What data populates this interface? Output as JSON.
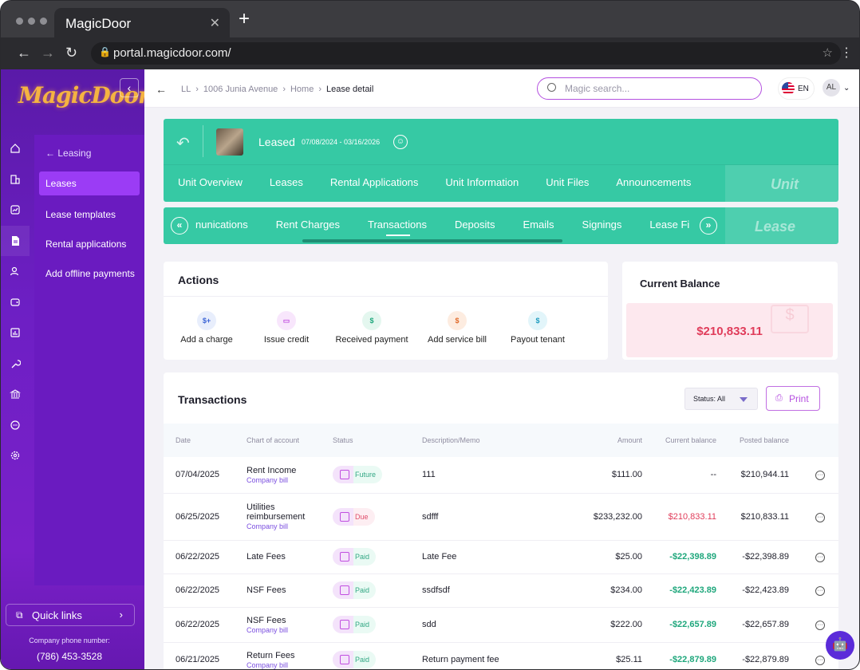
{
  "browser": {
    "tab_title": "MagicDoor",
    "tab_close": "✕",
    "new_tab": "+",
    "url": "portal.magicdoor.com/"
  },
  "sidebar": {
    "logo": "MagicDoor",
    "back_label": "Leasing",
    "items": [
      {
        "label": "Leases",
        "active": true
      },
      {
        "label": "Lease templates"
      },
      {
        "label": "Rental applications"
      },
      {
        "label": "Add offline payments"
      }
    ],
    "quick_links": "Quick links",
    "phone_label": "Company phone number:",
    "phone": "(786) 453-3528"
  },
  "topbar": {
    "breadcrumb": [
      "LL",
      "1006 Junia Avenue",
      "Home",
      "Lease detail"
    ],
    "search_placeholder": "Magic search...",
    "lang": "EN",
    "user_initials": "AL"
  },
  "lease": {
    "status": "Leased",
    "dates": "07/08/2024 - 03/16/2026",
    "unit_tabs": [
      "Unit Overview",
      "Leases",
      "Rental Applications",
      "Unit Information",
      "Unit Files",
      "Announcements"
    ],
    "unit_badge": "Unit",
    "lease_tabs": [
      "nunications",
      "Rent Charges",
      "Transactions",
      "Deposits",
      "Emails",
      "Signings",
      "Lease Fi"
    ],
    "active_lease_tab": "Transactions",
    "lease_badge": "Lease"
  },
  "actions": {
    "title": "Actions",
    "items": [
      {
        "label": "Add a charge",
        "icon": "add-charge-icon",
        "color": "#3c64d6",
        "bg": "#e8eefc",
        "glyph": "$+"
      },
      {
        "label": "Issue credit",
        "icon": "credit-card-icon",
        "color": "#c14fe0",
        "bg": "#f8e6fc",
        "glyph": "▭"
      },
      {
        "label": "Received payment",
        "icon": "hand-money-icon",
        "color": "#1fa77c",
        "bg": "#e4f7ef",
        "glyph": "$"
      },
      {
        "label": "Add service bill",
        "icon": "service-bill-icon",
        "color": "#e06a2a",
        "bg": "#fdece0",
        "glyph": "$"
      },
      {
        "label": "Payout tenant",
        "icon": "payout-icon",
        "color": "#1e9bbf",
        "bg": "#e2f5fa",
        "glyph": "$"
      }
    ]
  },
  "balance": {
    "title": "Current Balance",
    "amount": "$210,833.11"
  },
  "transactions": {
    "title": "Transactions",
    "filter": "Status: All",
    "print": "Print",
    "headers": {
      "date": "Date",
      "account": "Chart of account",
      "status": "Status",
      "desc": "Description/Memo",
      "amount": "Amount",
      "current": "Current balance",
      "posted": "Posted balance"
    },
    "rows": [
      {
        "date": "07/04/2025",
        "account": "Rent Income",
        "sub": "Company bill",
        "status": "Future",
        "desc": "111",
        "amount": "$111.00",
        "current": "--",
        "posted": "$210,944.11"
      },
      {
        "date": "06/25/2025",
        "account": "Utilities reimbursement",
        "sub": "Company bill",
        "status": "Due",
        "desc": "sdfff",
        "amount": "$233,232.00",
        "current": "$210,833.11",
        "posted": "$210,833.11"
      },
      {
        "date": "06/22/2025",
        "account": "Late Fees",
        "sub": "",
        "status": "Paid",
        "desc": "Late Fee",
        "amount": "$25.00",
        "current": "-$22,398.89",
        "posted": "-$22,398.89"
      },
      {
        "date": "06/22/2025",
        "account": "NSF Fees",
        "sub": "",
        "status": "Paid",
        "desc": "ssdfsdf",
        "amount": "$234.00",
        "current": "-$22,423.89",
        "posted": "-$22,423.89"
      },
      {
        "date": "06/22/2025",
        "account": "NSF Fees",
        "sub": "Company bill",
        "status": "Paid",
        "desc": "sdd",
        "amount": "$222.00",
        "current": "-$22,657.89",
        "posted": "-$22,657.89"
      },
      {
        "date": "06/21/2025",
        "account": "Return Fees",
        "sub": "Company bill",
        "status": "Paid",
        "desc": "Return payment fee",
        "amount": "$25.11",
        "current": "-$22,879.89",
        "posted": "-$22,879.89"
      }
    ]
  }
}
